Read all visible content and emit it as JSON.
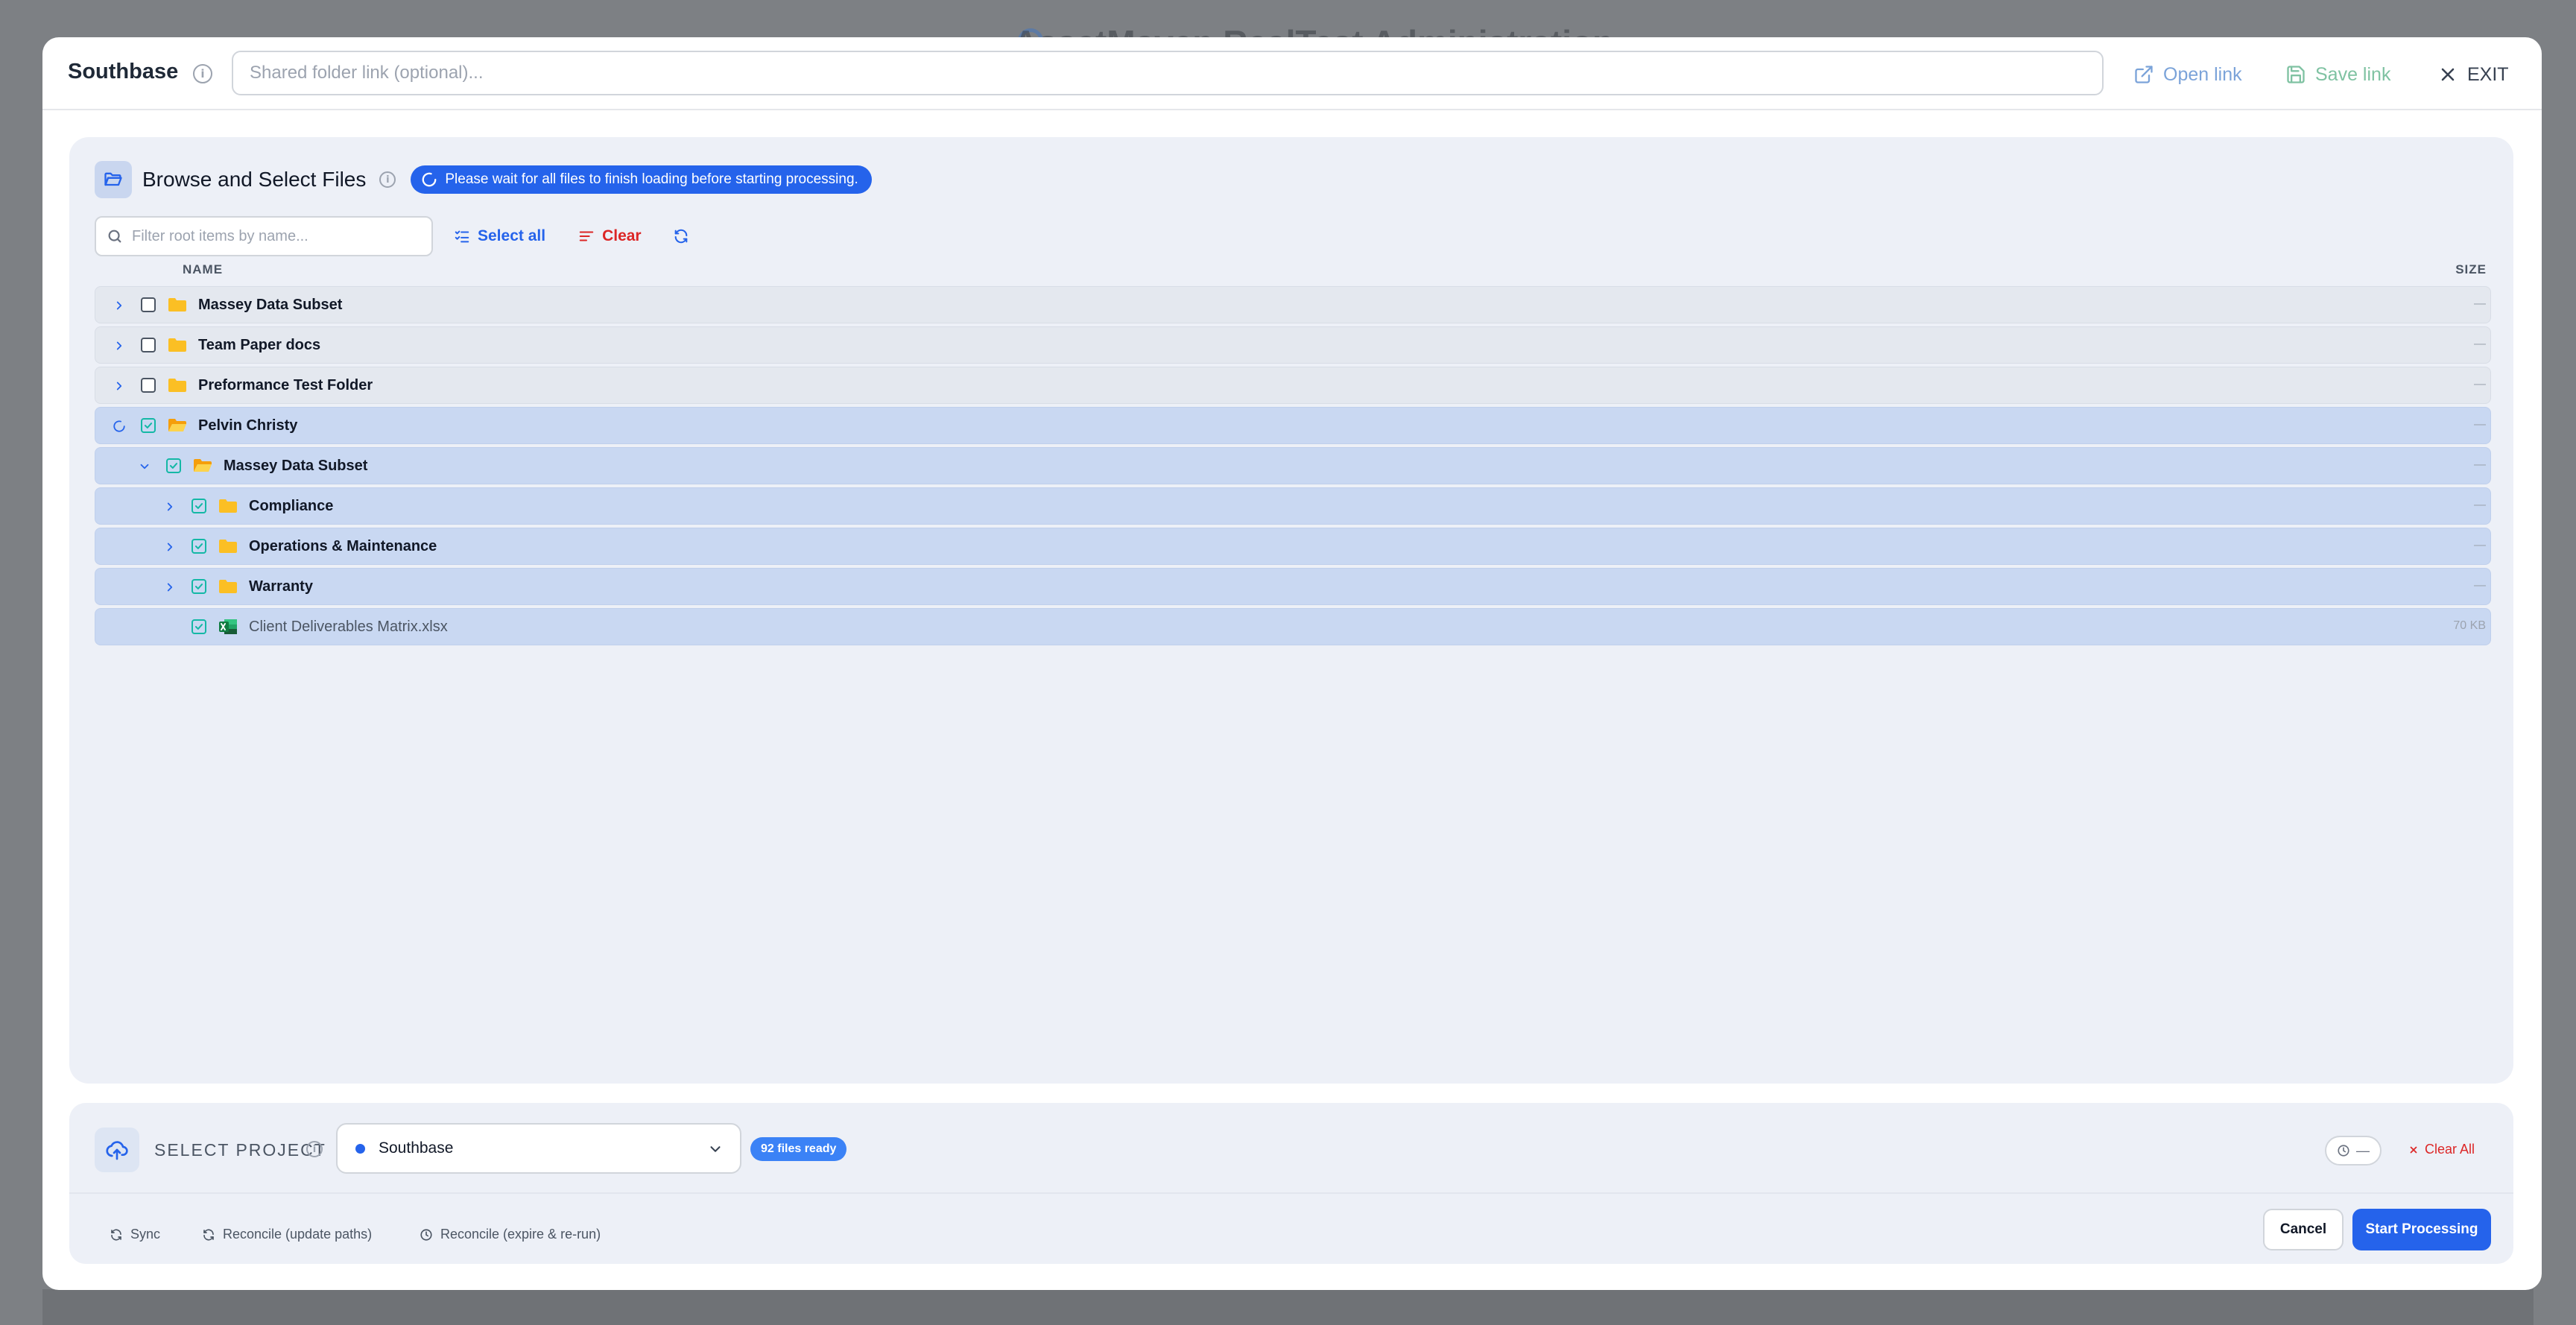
{
  "backdrop": {
    "title": "AssetMaven RealTest Administration"
  },
  "header": {
    "title": "Southbase",
    "link_placeholder": "Shared folder link (optional)...",
    "link_value": "",
    "open_link_label": "Open link",
    "save_link_label": "Save link",
    "exit_label": "EXIT"
  },
  "browser": {
    "title": "Browse and Select Files",
    "loading_notice": "Please wait for all files to finish loading before starting processing.",
    "filter_placeholder": "Filter root items by name...",
    "select_all_label": "Select all",
    "clear_label": "Clear",
    "columns": {
      "name": "NAME",
      "size": "SIZE"
    },
    "rows": [
      {
        "name": "Massey Data Subset",
        "type": "folder",
        "level": 0,
        "expander": "collapsed",
        "checked": false,
        "selected": false,
        "size": "—"
      },
      {
        "name": "Team Paper docs",
        "type": "folder",
        "level": 0,
        "expander": "collapsed",
        "checked": false,
        "selected": false,
        "size": "—"
      },
      {
        "name": "Preformance Test Folder",
        "type": "folder",
        "level": 0,
        "expander": "collapsed",
        "checked": false,
        "selected": false,
        "size": "—"
      },
      {
        "name": "Pelvin Christy",
        "type": "folder-open",
        "level": 0,
        "expander": "loading",
        "checked": true,
        "selected": true,
        "size": "—"
      },
      {
        "name": "Massey Data Subset",
        "type": "folder-open",
        "level": 1,
        "expander": "expanded",
        "checked": true,
        "selected": true,
        "size": "—"
      },
      {
        "name": "Compliance",
        "type": "folder",
        "level": 2,
        "expander": "collapsed",
        "checked": true,
        "selected": true,
        "size": "—"
      },
      {
        "name": "Operations & Maintenance",
        "type": "folder",
        "level": 2,
        "expander": "collapsed",
        "checked": true,
        "selected": true,
        "size": "—"
      },
      {
        "name": "Warranty",
        "type": "folder",
        "level": 2,
        "expander": "collapsed",
        "checked": true,
        "selected": true,
        "size": "—"
      },
      {
        "name": "Client Deliverables Matrix.xlsx",
        "type": "excel-file",
        "level": 2,
        "expander": "none",
        "checked": true,
        "selected": true,
        "size": "70 KB"
      }
    ]
  },
  "footer": {
    "select_project_label": "SELECT PROJECT",
    "project_value": "Southbase",
    "files_ready": "92 files ready",
    "history_value": "—",
    "clear_all_label": "Clear All",
    "sync_label": "Sync",
    "reconcile_update_label": "Reconcile (update paths)",
    "reconcile_expire_label": "Reconcile (expire & re-run)",
    "cancel_label": "Cancel",
    "start_label": "Start Processing"
  },
  "colors": {
    "accent": "#2563eb",
    "danger": "#dc2626",
    "checkbox_checked": "#14b8a6",
    "folder": "#fbbf24",
    "selected_row": "#c9d8f2"
  }
}
